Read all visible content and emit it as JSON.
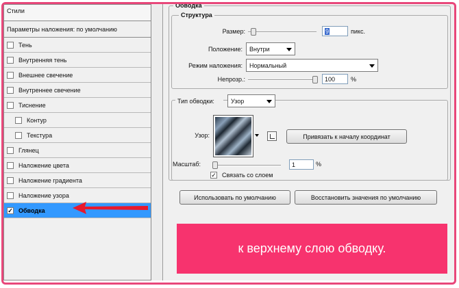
{
  "styles_panel": {
    "title": "Стили",
    "blend_default": "Параметры наложения: по умолчанию",
    "items": [
      {
        "label": "Тень",
        "checked": false,
        "sub": false
      },
      {
        "label": "Внутренняя тень",
        "checked": false,
        "sub": false
      },
      {
        "label": "Внешнее свечение",
        "checked": false,
        "sub": false
      },
      {
        "label": "Внутреннее свечение",
        "checked": false,
        "sub": false
      },
      {
        "label": "Тиснение",
        "checked": false,
        "sub": false
      },
      {
        "label": "Контур",
        "checked": false,
        "sub": true
      },
      {
        "label": "Текстура",
        "checked": false,
        "sub": true
      },
      {
        "label": "Глянец",
        "checked": false,
        "sub": false
      },
      {
        "label": "Наложение цвета",
        "checked": false,
        "sub": false
      },
      {
        "label": "Наложение градиента",
        "checked": false,
        "sub": false
      },
      {
        "label": "Наложение узора",
        "checked": false,
        "sub": false
      },
      {
        "label": "Обводка",
        "checked": true,
        "sub": false,
        "selected": true
      }
    ]
  },
  "stroke": {
    "group_title": "Обводка",
    "structure_title": "Структура",
    "size_label": "Размер:",
    "size_value": "9",
    "size_unit": "пикс.",
    "position_label": "Положение:",
    "position_value": "Внутри",
    "blend_label": "Режим наложения:",
    "blend_value": "Нормальный",
    "opacity_label": "Непрозр.:",
    "opacity_value": "100",
    "opacity_unit": "%",
    "size_slider_level": 0.02,
    "opacity_slider_level": 1.0
  },
  "fill": {
    "type_label": "Тип обводки:",
    "type_value": "Узор",
    "pattern_label": "Узор:",
    "snap_button": "Привязать к началу координат",
    "scale_label": "Масштаб:",
    "scale_value": "1",
    "scale_unit": "%",
    "scale_slider_level": 0.0,
    "link_label": "Связать со слоем",
    "link_checked": true
  },
  "buttons": {
    "use_default": "Использовать по умолчанию",
    "reset_default": "Восстановить значения по умолчанию"
  },
  "callout": {
    "text": "к верхнему слою обводку."
  },
  "colors": {
    "accent": "#e8477a",
    "callout_bg": "#f7336e",
    "selection": "#3399ff",
    "arrow": "#e8192c"
  }
}
